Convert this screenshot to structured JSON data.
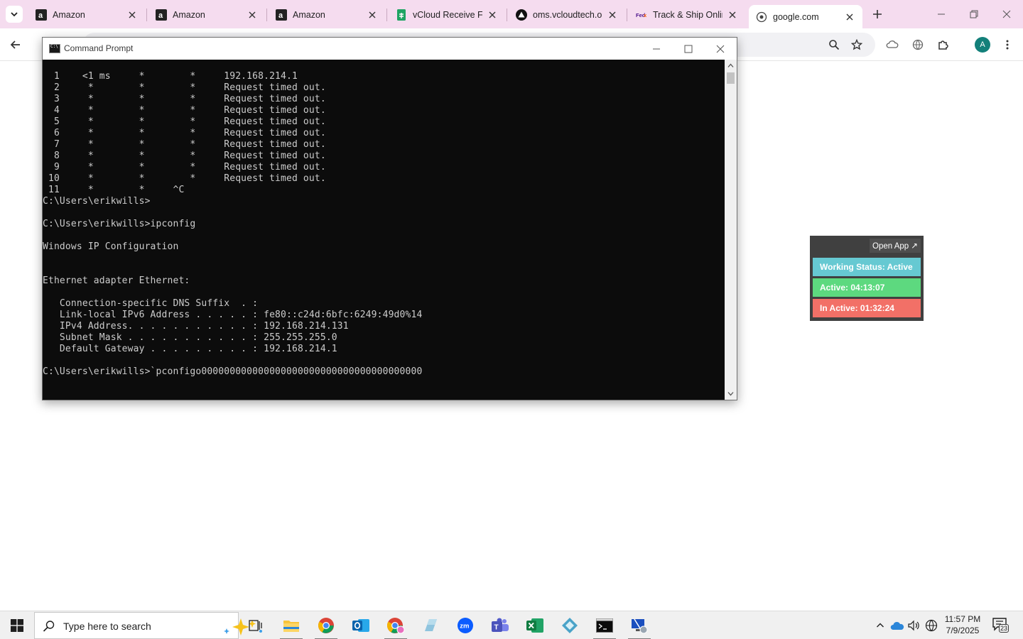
{
  "browser": {
    "tabs": [
      {
        "title": "Amazon",
        "favicon": "amazon-icon"
      },
      {
        "title": "Amazon",
        "favicon": "amazon-icon"
      },
      {
        "title": "Amazon",
        "favicon": "amazon-icon"
      },
      {
        "title": "vCloud Receive Fil",
        "favicon": "sheets-icon"
      },
      {
        "title": "oms.vcloudtech.or",
        "favicon": "triangle-logo-icon"
      },
      {
        "title": "Track & Ship Onlin",
        "favicon": "fedex-icon"
      },
      {
        "title": "google.com",
        "favicon": "globe-icon",
        "active": true
      }
    ],
    "avatar_letter": "A"
  },
  "cmd": {
    "title": "Command Prompt",
    "lines": [
      "  1    <1 ms     *        *     192.168.214.1",
      "  2     *        *        *     Request timed out.",
      "  3     *        *        *     Request timed out.",
      "  4     *        *        *     Request timed out.",
      "  5     *        *        *     Request timed out.",
      "  6     *        *        *     Request timed out.",
      "  7     *        *        *     Request timed out.",
      "  8     *        *        *     Request timed out.",
      "  9     *        *        *     Request timed out.",
      " 10     *        *        *     Request timed out.",
      " 11     *        *     ^C",
      "C:\\Users\\erikwills>",
      "",
      "C:\\Users\\erikwills>ipconfig",
      "",
      "Windows IP Configuration",
      "",
      "",
      "Ethernet adapter Ethernet:",
      "",
      "   Connection-specific DNS Suffix  . :",
      "   Link-local IPv6 Address . . . . . : fe80::c24d:6bfc:6249:49d0%14",
      "   IPv4 Address. . . . . . . . . . . : 192.168.214.131",
      "   Subnet Mask . . . . . . . . . . . : 255.255.255.0",
      "   Default Gateway . . . . . . . . . : 192.168.214.1",
      "",
      "C:\\Users\\erikwills>`pconfigo000000000000000000000000000000000000000"
    ]
  },
  "widget": {
    "open_app": "Open App ↗",
    "status": "Working Status: Active",
    "active": "Active: 04:13:07",
    "inactive": "In Active: 01:32:24",
    "colors": {
      "status": "#66c9d2",
      "active": "#5dd97f",
      "inactive": "#f27067"
    }
  },
  "taskbar": {
    "search_placeholder": "Type here to search",
    "time": "11:57 PM",
    "date": "7/9/2025",
    "notification_count": "23"
  }
}
